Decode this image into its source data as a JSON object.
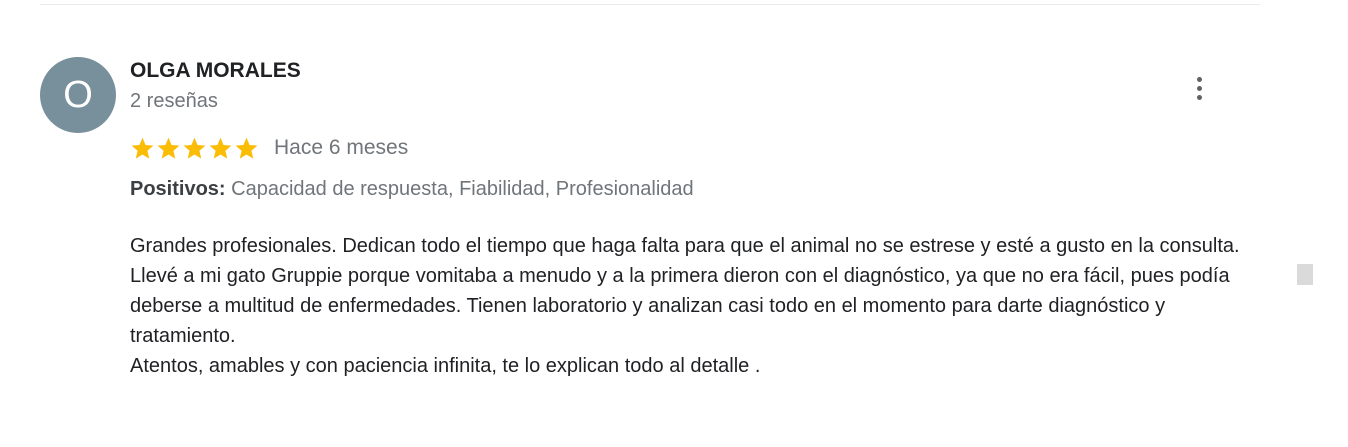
{
  "review": {
    "avatar_letter": "O",
    "avatar_color": "#78909c",
    "reviewer_name": "OLGA MORALES",
    "review_count": "2 reseñas",
    "rating": 5,
    "rating_max": 5,
    "star_color": "#fbbc04",
    "time_ago": "Hace 6 meses",
    "highlights_label": "Positivos:",
    "highlights_values": "Capacidad de respuesta, Fiabilidad, Profesionalidad",
    "text": "Grandes profesionales. Dedican todo el tiempo que haga falta para que el animal no se estrese y esté a gusto en la consulta. Llevé a mi gato Gruppie porque vomitaba a menudo y a la primera dieron con el diagnóstico, ya que no era fácil, pues podía deberse a multitud de enfermedades. Tienen laboratorio y analizan casi todo en el momento para darte diagnóstico y tratamiento.\nAtentos, amables y con paciencia infinita, te lo explican todo al detalle ."
  },
  "icons": {
    "menu": "more-vert-icon",
    "star": "star-icon"
  }
}
